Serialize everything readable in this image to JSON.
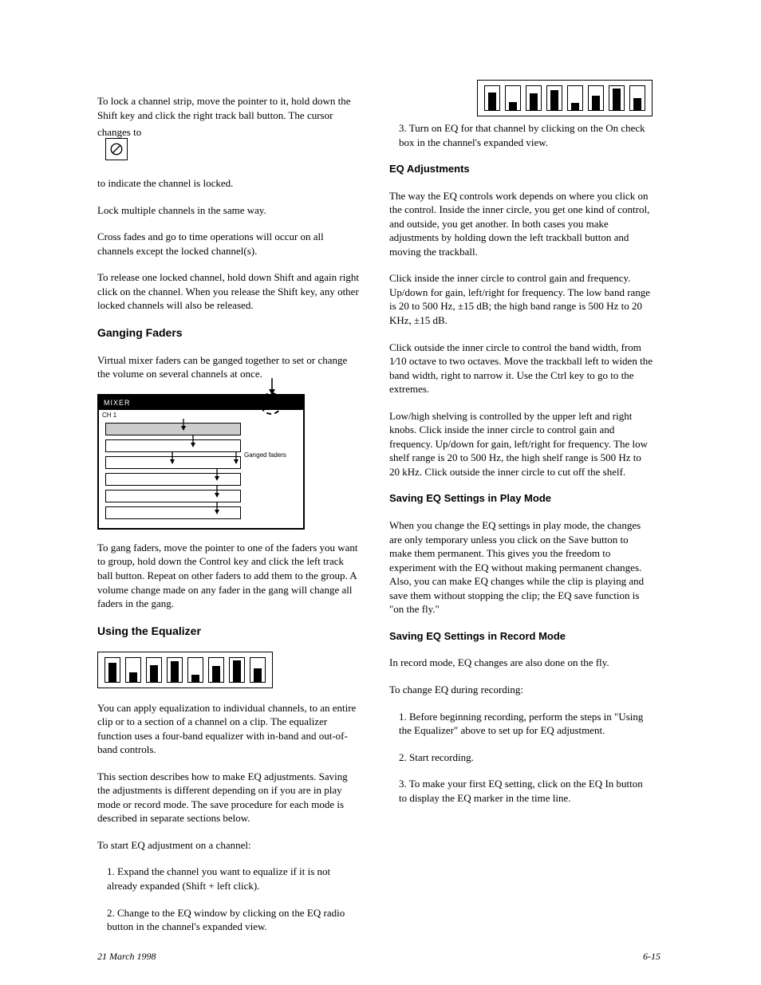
{
  "left": {
    "p1": "To lock a channel strip, move the pointer to it, hold down the Shift key and click the right track ball button. The cursor changes to",
    "p1b": "to indicate the channel is locked.",
    "p2": "Lock multiple channels in the same way.",
    "p3": "Cross fades and go to time operations will occur on all channels except the locked channel(s).",
    "p4": "To release one locked channel, hold down Shift and again right click on the channel. When you release the Shift key, any other locked channels will also be released.",
    "h1": "Ganging Faders",
    "p5": "Virtual mixer faders can be ganged together to set or change the volume on several channels at once.",
    "mixer": {
      "title": "MIXER",
      "ch_label": "CH 1",
      "ganged": "Ganged faders"
    },
    "p6": "To gang faders, move the pointer to one of the faders you want to group, hold down the Control key and click the left track ball button. Repeat on other faders to add them to the group. A volume change made on any fader in the gang will change all faders in the gang.",
    "h2": "Using the Equalizer",
    "p8": "You can apply equalization to individual channels, to an entire clip or to a section of a channel on a clip. The equalizer function uses a four-band equalizer with in-band and out-of-band controls.",
    "p9": "This section describes how to make EQ adjustments. Saving the adjustments is different depending on if you are in play mode or record mode. The save procedure for each mode is described in separate sections below.",
    "p10": "To start EQ adjustment on a channel:",
    "p11": "1. Expand the channel you want to equalize if it is not already expanded (Shift + left click).",
    "p12": "2. Change to the EQ window by clicking on the EQ radio button in the channel's expanded view."
  },
  "right": {
    "p1": "3. Turn on EQ for that channel by clicking on the On check box in the channel's expanded view.",
    "h1": "EQ Adjustments",
    "p2": "The way the EQ controls work depends on where you click on the control. Inside the inner circle, you get one kind of control, and outside, you get another. In both cases you make adjustments by holding down the left trackball button and moving the trackball.",
    "p3_a": "Click inside the inner circle to control gain and frequency. Up/down for gain, left/right for frequency. The low band range is 20 to 500 Hz, ",
    "p3_b": "15 dB; the high band range is 500 Hz to 20 KHz, ",
    "p3_c": "15 dB.",
    "plusminus": "±",
    "p4_a": "Click outside the inner circle to control the band width, from ",
    "p4_b": " octave to two octaves. Move the trackball left to widen the band width, right to narrow it. Use the Ctrl key to go to the extremes.",
    "onetenth": "1⁄10",
    "p5": "Low/high shelving is controlled by the upper left and right knobs. Click inside the inner circle to control gain and frequency. Up/down for gain, left/right for frequency. The low shelf range is 20 to 500 Hz, the high shelf range is 500 Hz to 20 kHz. Click outside the inner circle to cut off the shelf.",
    "h2": "Saving EQ Settings in Play Mode",
    "p6": "When you change the EQ settings in play mode, the changes are only temporary unless you click on the Save button to make them permanent. This gives you the freedom to experiment with the EQ without making permanent changes. Also, you can make EQ changes while the clip is playing and save them without stopping the clip; the EQ save function is \"on the fly.\"",
    "h3": "Saving EQ Settings in Record Mode",
    "p7": "In record mode, EQ changes are also done on the fly.",
    "p8": "To change EQ during recording:",
    "p9": "1. Before beginning recording, perform the steps in \"Using the Equalizer\" above to set up for EQ adjustment.",
    "p10": "2. Start recording.",
    "p11": "3. To make your first EQ setting, click on the EQ In button to display the EQ marker in the time line."
  },
  "footer": {
    "left": "21 March 1998",
    "right": "6-15"
  }
}
